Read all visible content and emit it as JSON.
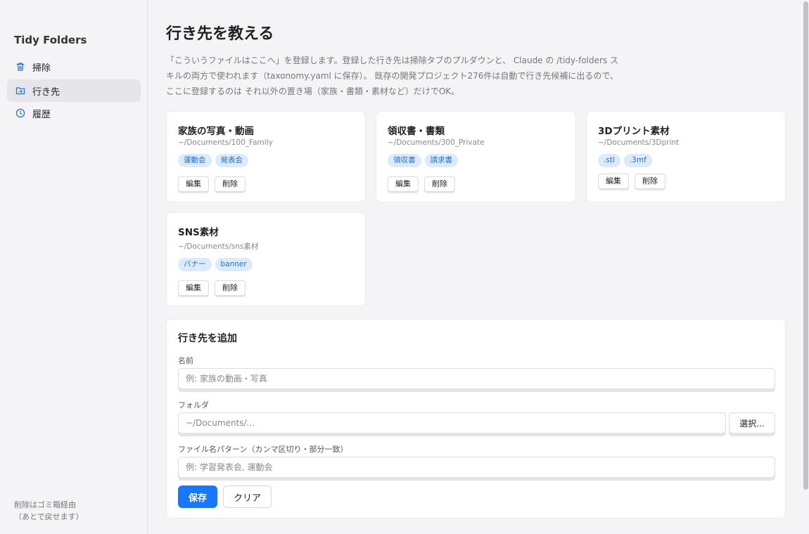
{
  "sidebar": {
    "app_title": "Tidy Folders",
    "items": [
      {
        "label": "掃除",
        "icon": "trash-icon"
      },
      {
        "label": "行き先",
        "icon": "folder-arrow-icon",
        "active": true
      },
      {
        "label": "履歴",
        "icon": "clock-icon"
      }
    ],
    "footer_line1": "削除はゴミ箱経由",
    "footer_line2": "（あとで戻せます）"
  },
  "main": {
    "title": "行き先を教える",
    "description": "「こういうファイルはここへ」を登録します。登録した行き先は掃除タブのプルダウンと、 Claude の /tidy-folders スキルの両方で使われます（taxonomy.yaml に保存）。 既存の開発プロジェクト276件は自動で行き先候補に出るので、ここに登録するのは それ以外の置き場（家族・書類・素材など）だけでOK。",
    "cards": [
      {
        "title": "家族の写真・動画",
        "path": "~/Documents/100_Family",
        "tags": [
          "運動会",
          "発表会"
        ],
        "edit": "編集",
        "delete": "削除"
      },
      {
        "title": "領収書・書類",
        "path": "~/Documents/300_Private",
        "tags": [
          "領収書",
          "請求書"
        ],
        "edit": "編集",
        "delete": "削除"
      },
      {
        "title": "3Dプリント素材",
        "path": "~/Documents/3Dprint",
        "tags": [
          ".stl",
          ".3mf"
        ],
        "edit": "編集",
        "delete": "削除"
      },
      {
        "title": "SNS素材",
        "path": "~/Documents/sns素材",
        "tags": [
          "バナー",
          "banner"
        ],
        "edit": "編集",
        "delete": "削除"
      }
    ]
  },
  "form": {
    "title": "行き先を追加",
    "name_label": "名前",
    "name_placeholder": "例: 家族の動画・写真",
    "folder_label": "フォルダ",
    "folder_placeholder": "~/Documents/...",
    "select_button": "選択...",
    "pattern_label": "ファイル名パターン（カンマ区切り・部分一致）",
    "pattern_placeholder": "例: 学習発表会, 運動会",
    "save_button": "保存",
    "clear_button": "クリア"
  },
  "colors": {
    "accent": "#1677ff",
    "tag_bg": "#dbeafc",
    "tag_text": "#1e6fd0",
    "icon_blue": "#1e6fd0"
  }
}
